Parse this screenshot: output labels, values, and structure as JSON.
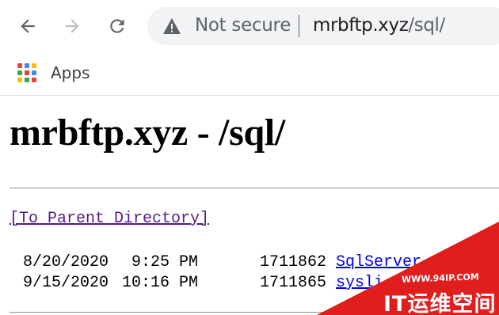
{
  "browser": {
    "back_icon": "arrow-left-icon",
    "forward_icon": "arrow-right-icon",
    "reload_icon": "reload-icon",
    "security_icon": "warning-triangle-icon",
    "security_label": "Not secure",
    "url_host": "mrbftp.xyz",
    "url_path": "/sql/"
  },
  "bookmarks": {
    "apps_label": "Apps",
    "apps_colors": [
      "#ea4335",
      "#4285f4",
      "#fbbc05",
      "#34a853",
      "#ea4335",
      "#4285f4",
      "#fbbc05",
      "#34a853",
      "#ea4335"
    ]
  },
  "page": {
    "title": "mrbftp.xyz - /sql/",
    "parent_link": "[To Parent Directory]",
    "files": [
      {
        "date": "8/20/2020",
        "time": "9:25 PM",
        "size": "1711862",
        "name": "SqlServer"
      },
      {
        "date": "9/15/2020",
        "time": "10:16 PM",
        "size": "1711865",
        "name": "sysli"
      }
    ]
  },
  "watermark": {
    "url_text": "WWW.94IP.COM",
    "brand_text": "IT运维空间",
    "color": "#e01e1e"
  },
  "colors": {
    "link_visited": "#551a8b",
    "link": "#0000ee",
    "omnibox_bg": "#f1f3f4"
  }
}
